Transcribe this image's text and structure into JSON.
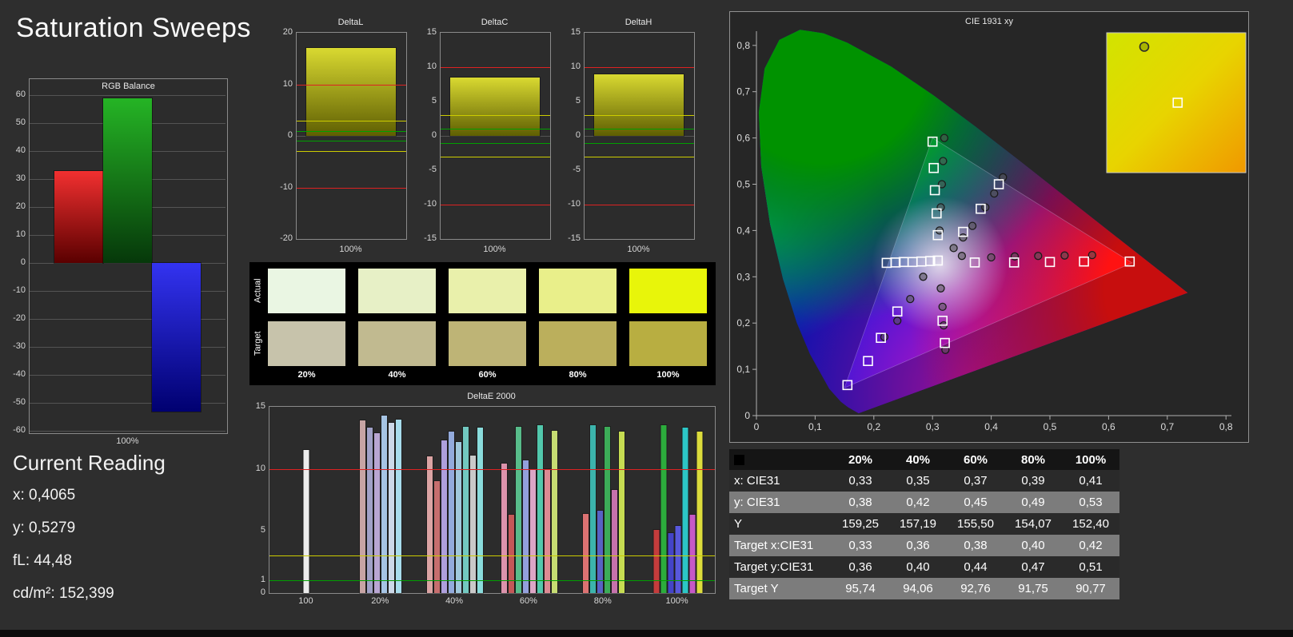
{
  "title": "Saturation Sweeps",
  "current_reading": {
    "title": "Current Reading",
    "lines": [
      "x: 0,4065",
      "y: 0,5279",
      "fL: 44,48",
      "cd/m²: 152,399"
    ]
  },
  "swatches": {
    "row_labels": [
      "Actual",
      "Target"
    ],
    "col_labels": [
      "20%",
      "40%",
      "60%",
      "80%",
      "100%"
    ],
    "actual": [
      "#eaf6e3",
      "#e7f0c6",
      "#e9f0ab",
      "#e9ef8a",
      "#e8f50a"
    ],
    "target": [
      "#c7c3ab",
      "#c1ba90",
      "#beb476",
      "#bbaf5c",
      "#b8ae41"
    ]
  },
  "table": {
    "columns": [
      "20%",
      "40%",
      "60%",
      "80%",
      "100%"
    ],
    "rows": [
      {
        "label": "x: CIE31",
        "values": [
          "0,33",
          "0,35",
          "0,37",
          "0,39",
          "0,41"
        ]
      },
      {
        "label": "y: CIE31",
        "values": [
          "0,38",
          "0,42",
          "0,45",
          "0,49",
          "0,53"
        ]
      },
      {
        "label": "Y",
        "values": [
          "159,25",
          "157,19",
          "155,50",
          "154,07",
          "152,40"
        ]
      },
      {
        "label": "Target x:CIE31",
        "values": [
          "0,33",
          "0,36",
          "0,38",
          "0,40",
          "0,42"
        ]
      },
      {
        "label": "Target y:CIE31",
        "values": [
          "0,36",
          "0,40",
          "0,44",
          "0,47",
          "0,51"
        ]
      },
      {
        "label": "Target Y",
        "values": [
          "95,74",
          "94,06",
          "92,76",
          "91,75",
          "90,77"
        ]
      }
    ]
  },
  "chart_data": [
    {
      "id": "rgb_balance",
      "type": "bar",
      "title": "RGB Balance",
      "categories": [
        "Red",
        "Green",
        "Blue"
      ],
      "values": [
        33,
        59,
        -53
      ],
      "gradients": [
        [
          "#f23030",
          "#5a0000"
        ],
        [
          "#25b425",
          "#06380a"
        ],
        [
          "#3333f0",
          "#000070"
        ]
      ],
      "xlabel": "100%",
      "ylim": [
        -60,
        60
      ],
      "yticks": [
        60,
        50,
        40,
        30,
        20,
        10,
        0,
        -10,
        -20,
        -30,
        -40,
        -50,
        -60
      ]
    },
    {
      "id": "deltaL",
      "type": "bar",
      "title": "DeltaL",
      "categories": [
        "100%"
      ],
      "values": [
        17
      ],
      "xlabel": "100%",
      "ylim": [
        -20,
        20
      ],
      "yticks": [
        20,
        10,
        0,
        -10,
        -20
      ],
      "ref_lines": [
        {
          "y": 10,
          "color": "#dd2222"
        },
        {
          "y": -10,
          "color": "#dd2222"
        },
        {
          "y": 3,
          "color": "#cccc00"
        },
        {
          "y": -3,
          "color": "#cccc00"
        },
        {
          "y": 1,
          "color": "#00a000"
        },
        {
          "y": -1,
          "color": "#00a000"
        }
      ]
    },
    {
      "id": "deltaC",
      "type": "bar",
      "title": "DeltaC",
      "categories": [
        "100%"
      ],
      "values": [
        8.5
      ],
      "xlabel": "100%",
      "ylim": [
        -15,
        15
      ],
      "yticks": [
        15,
        10,
        5,
        0,
        -5,
        -10,
        -15
      ],
      "ref_lines": [
        {
          "y": 10,
          "color": "#dd2222"
        },
        {
          "y": -10,
          "color": "#dd2222"
        },
        {
          "y": 3,
          "color": "#cccc00"
        },
        {
          "y": -3,
          "color": "#cccc00"
        },
        {
          "y": 1,
          "color": "#00a000"
        },
        {
          "y": -1,
          "color": "#00a000"
        }
      ]
    },
    {
      "id": "deltaH",
      "type": "bar",
      "title": "DeltaH",
      "categories": [
        "100%"
      ],
      "values": [
        9
      ],
      "xlabel": "100%",
      "ylim": [
        -15,
        15
      ],
      "yticks": [
        15,
        10,
        5,
        0,
        -5,
        -10,
        -15
      ],
      "ref_lines": [
        {
          "y": 10,
          "color": "#dd2222"
        },
        {
          "y": -10,
          "color": "#dd2222"
        },
        {
          "y": 3,
          "color": "#cccc00"
        },
        {
          "y": -3,
          "color": "#cccc00"
        },
        {
          "y": 1,
          "color": "#00a000"
        },
        {
          "y": -1,
          "color": "#00a000"
        }
      ]
    },
    {
      "id": "deltae2000",
      "type": "bar",
      "title": "DeltaE 2000",
      "ylim": [
        0,
        15
      ],
      "yticks": [
        15,
        10,
        5,
        1,
        0
      ],
      "ref_lines": [
        {
          "y": 10,
          "color": "#dd2222"
        },
        {
          "y": 3,
          "color": "#cccc00"
        },
        {
          "y": 1,
          "color": "#00a000"
        }
      ],
      "groups": [
        {
          "label": "100",
          "bars": [
            {
              "color": "#ececec",
              "value": 11.5
            }
          ]
        },
        {
          "label": "20%",
          "bars": [
            {
              "color": "#c7a4a4",
              "value": 13.9
            },
            {
              "color": "#a1a1c7",
              "value": 13.3
            },
            {
              "color": "#b9a6d2",
              "value": 12.9
            },
            {
              "color": "#a6c4e4",
              "value": 14.3
            },
            {
              "color": "#ccd8e8",
              "value": 13.7
            },
            {
              "color": "#a8dcec",
              "value": 14.0
            }
          ]
        },
        {
          "label": "40%",
          "bars": [
            {
              "color": "#dba4a4",
              "value": 11.0
            },
            {
              "color": "#c66e6e",
              "value": 9.0
            },
            {
              "color": "#ae9fdc",
              "value": 12.3
            },
            {
              "color": "#93aadc",
              "value": 13.0
            },
            {
              "color": "#a0c8dc",
              "value": 12.2
            },
            {
              "color": "#72c8c0",
              "value": 13.4
            },
            {
              "color": "#c9c9c9",
              "value": 11.1
            },
            {
              "color": "#8adcdc",
              "value": 13.3
            }
          ]
        },
        {
          "label": "60%",
          "bars": [
            {
              "color": "#dc93ac",
              "value": 10.4
            },
            {
              "color": "#c45858",
              "value": 6.3
            },
            {
              "color": "#58bc8a",
              "value": 13.4
            },
            {
              "color": "#93a0dc",
              "value": 10.7
            },
            {
              "color": "#dca6c6",
              "value": 9.9
            },
            {
              "color": "#52c8ac",
              "value": 13.5
            },
            {
              "color": "#dc8a93",
              "value": 10.0
            },
            {
              "color": "#c6dc72",
              "value": 13.1
            }
          ]
        },
        {
          "label": "80%",
          "bars": [
            {
              "color": "#dc7272",
              "value": 6.4
            },
            {
              "color": "#3cb4ac",
              "value": 13.5
            },
            {
              "color": "#5862c4",
              "value": 6.6
            },
            {
              "color": "#3cac58",
              "value": 13.4
            },
            {
              "color": "#c672ac",
              "value": 8.3
            },
            {
              "color": "#c6dc52",
              "value": 13.0
            }
          ]
        },
        {
          "label": "100%",
          "bars": [
            {
              "color": "#c43c3c",
              "value": 5.1
            },
            {
              "color": "#2cac3c",
              "value": 13.5
            },
            {
              "color": "#4444c8",
              "value": 4.8
            },
            {
              "color": "#5858dc",
              "value": 5.4
            },
            {
              "color": "#2cc6c6",
              "value": 13.3
            },
            {
              "color": "#c658c6",
              "value": 6.3
            },
            {
              "color": "#dcdc3c",
              "value": 13.0
            }
          ]
        }
      ]
    },
    {
      "id": "cie1931",
      "type": "scatter",
      "title": "CIE 1931 xy",
      "xticks": [
        "0",
        "0,1",
        "0,2",
        "0,3",
        "0,4",
        "0,5",
        "0,6",
        "0,7",
        "0,8"
      ],
      "yticks": [
        "0",
        "0,1",
        "0,2",
        "0,3",
        "0,4",
        "0,5",
        "0,6",
        "0,7",
        "0,8"
      ],
      "squares": [
        [
          0.155,
          0.066
        ],
        [
          0.19,
          0.118
        ],
        [
          0.212,
          0.168
        ],
        [
          0.24,
          0.225
        ],
        [
          0.222,
          0.33
        ],
        [
          0.237,
          0.331
        ],
        [
          0.251,
          0.332
        ],
        [
          0.266,
          0.332
        ],
        [
          0.281,
          0.333
        ],
        [
          0.296,
          0.334
        ],
        [
          0.309,
          0.335
        ],
        [
          0.372,
          0.331
        ],
        [
          0.439,
          0.331
        ],
        [
          0.5,
          0.332
        ],
        [
          0.558,
          0.333
        ],
        [
          0.636,
          0.333
        ],
        [
          0.3,
          0.592
        ],
        [
          0.302,
          0.535
        ],
        [
          0.304,
          0.487
        ],
        [
          0.307,
          0.437
        ],
        [
          0.309,
          0.39
        ],
        [
          0.352,
          0.397
        ],
        [
          0.382,
          0.447
        ],
        [
          0.413,
          0.5
        ],
        [
          0.317,
          0.205
        ],
        [
          0.321,
          0.157
        ]
      ],
      "circles": [
        [
          0.32,
          0.6
        ],
        [
          0.318,
          0.55
        ],
        [
          0.316,
          0.5
        ],
        [
          0.314,
          0.45
        ],
        [
          0.312,
          0.4
        ],
        [
          0.336,
          0.362
        ],
        [
          0.352,
          0.385
        ],
        [
          0.368,
          0.41
        ],
        [
          0.39,
          0.45
        ],
        [
          0.405,
          0.48
        ],
        [
          0.42,
          0.515
        ],
        [
          0.35,
          0.345
        ],
        [
          0.4,
          0.342
        ],
        [
          0.44,
          0.344
        ],
        [
          0.48,
          0.345
        ],
        [
          0.525,
          0.346
        ],
        [
          0.572,
          0.347
        ],
        [
          0.284,
          0.3
        ],
        [
          0.262,
          0.252
        ],
        [
          0.24,
          0.205
        ],
        [
          0.218,
          0.17
        ],
        [
          0.314,
          0.275
        ],
        [
          0.317,
          0.235
        ],
        [
          0.319,
          0.195
        ],
        [
          0.322,
          0.142
        ]
      ],
      "inset": {
        "circle": [
          0.27,
          0.1
        ],
        "square": [
          0.51,
          0.5
        ]
      }
    }
  ]
}
